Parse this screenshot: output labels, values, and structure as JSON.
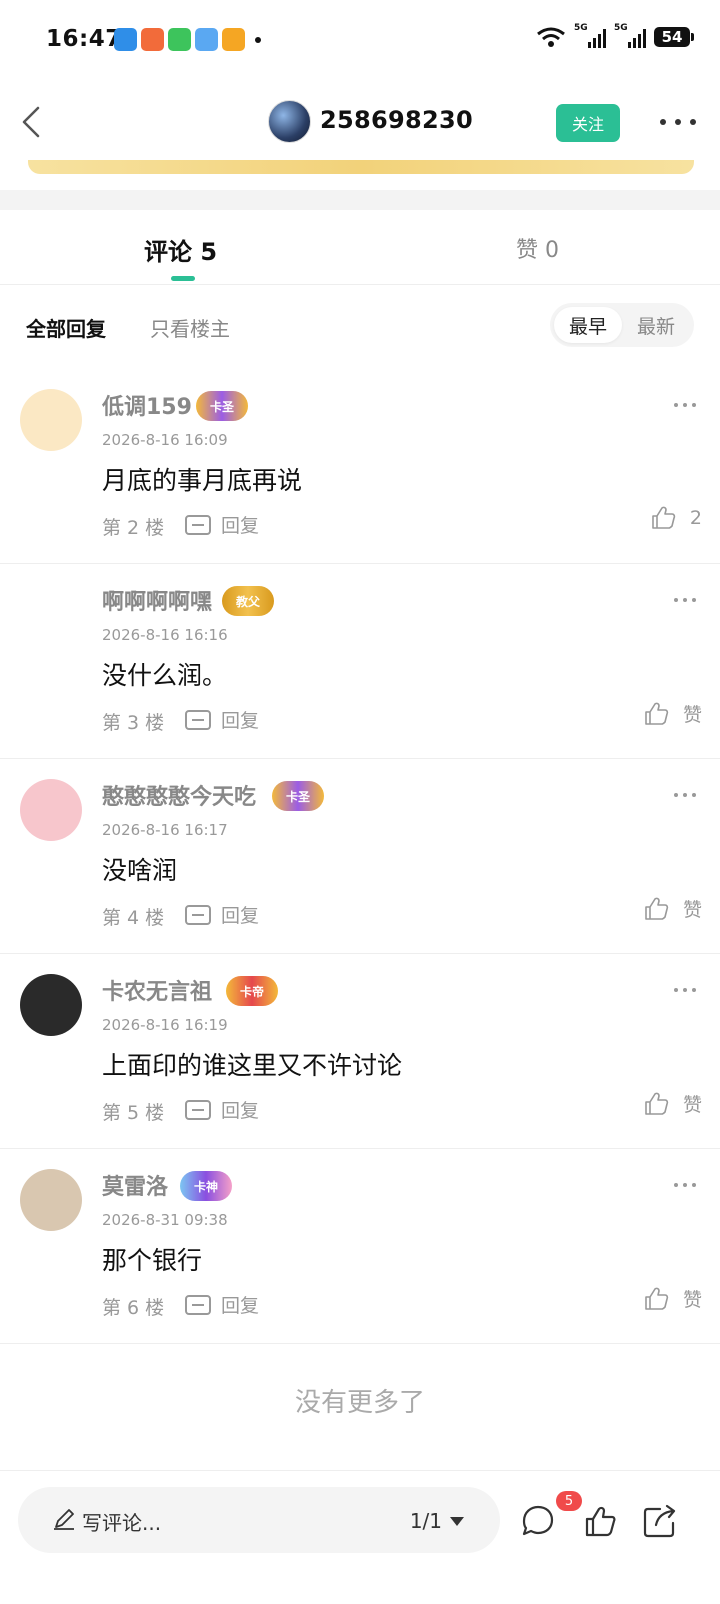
{
  "status_bar": {
    "time": "16:47",
    "battery": "54",
    "network1": "5G",
    "network2": "5G"
  },
  "header": {
    "title": "258698230",
    "follow_label": "关注"
  },
  "tabs": {
    "comments_label": "评论 5",
    "likes_label": "赞 0"
  },
  "filters": {
    "all_label": "全部回复",
    "owner_label": "只看楼主",
    "sort_earliest": "最早",
    "sort_latest": "最新"
  },
  "comments": [
    {
      "name": "低调159",
      "badge": "卡圣",
      "time": "2026-8-16 16:09",
      "text": "月底的事月底再说",
      "floor": "第 2 楼",
      "reply_label": "回复",
      "likes": "2",
      "avatar_color": "#fbe8c4"
    },
    {
      "name": "啊啊啊啊嘿",
      "badge": "教父",
      "time": "2026-8-16 16:16",
      "text": "没什么润。",
      "floor": "第 3 楼",
      "reply_label": "回复",
      "likes": "赞",
      "avatar_color": "#ffffff"
    },
    {
      "name": "憨憨憨憨今天吃",
      "badge": "卡圣",
      "time": "2026-8-16 16:17",
      "text": "没啥润",
      "floor": "第 4 楼",
      "reply_label": "回复",
      "likes": "赞",
      "avatar_color": "#f7c6cc"
    },
    {
      "name": "卡农无言祖",
      "badge": "卡帝",
      "time": "2026-8-16 16:19",
      "text": "上面印的谁这里又不许讨论",
      "floor": "第 5 楼",
      "reply_label": "回复",
      "likes": "赞",
      "avatar_color": "#2a2a2a"
    },
    {
      "name": "莫雷洛",
      "badge": "卡神",
      "time": "2026-8-31 09:38",
      "text": "那个银行",
      "floor": "第 6 楼",
      "reply_label": "回复",
      "likes": "赞",
      "avatar_color": "#d9c7b0"
    }
  ],
  "footer": {
    "no_more": "没有更多了"
  },
  "bottom_bar": {
    "input_placeholder": "写评论...",
    "page_indicator": "1/1",
    "message_count": "5"
  },
  "colors": {
    "accent": "#2bbf95",
    "badge_red": "#f04a4a"
  }
}
